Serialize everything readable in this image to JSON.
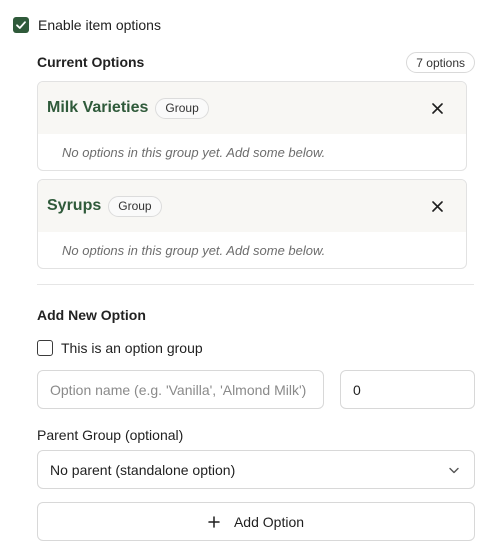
{
  "enable": {
    "label": "Enable item options",
    "checked": true
  },
  "current": {
    "title": "Current Options",
    "count_label": "7 options"
  },
  "groups": [
    {
      "name": "Milk Varieties",
      "badge": "Group",
      "empty_text": "No options in this group yet. Add some below."
    },
    {
      "name": "Syrups",
      "badge": "Group",
      "empty_text": "No options in this group yet. Add some below."
    }
  ],
  "add_new": {
    "title": "Add New Option",
    "group_checkbox_label": "This is an option group",
    "group_checkbox_checked": false,
    "name_placeholder": "Option name (e.g. 'Vanilla', 'Almond Milk')",
    "name_value": "",
    "price_value": "0",
    "parent_label": "Parent Group (optional)",
    "parent_selected": "No parent (standalone option)",
    "add_button_label": "Add Option"
  },
  "colors": {
    "accent": "#2f5a3a",
    "group_header_bg": "#f8f7f4",
    "border": "#e2e2e2"
  },
  "icons": {
    "checkbox": "check-icon",
    "close": "close-icon",
    "dropdown": "chevron-down-icon",
    "add": "plus-icon"
  }
}
